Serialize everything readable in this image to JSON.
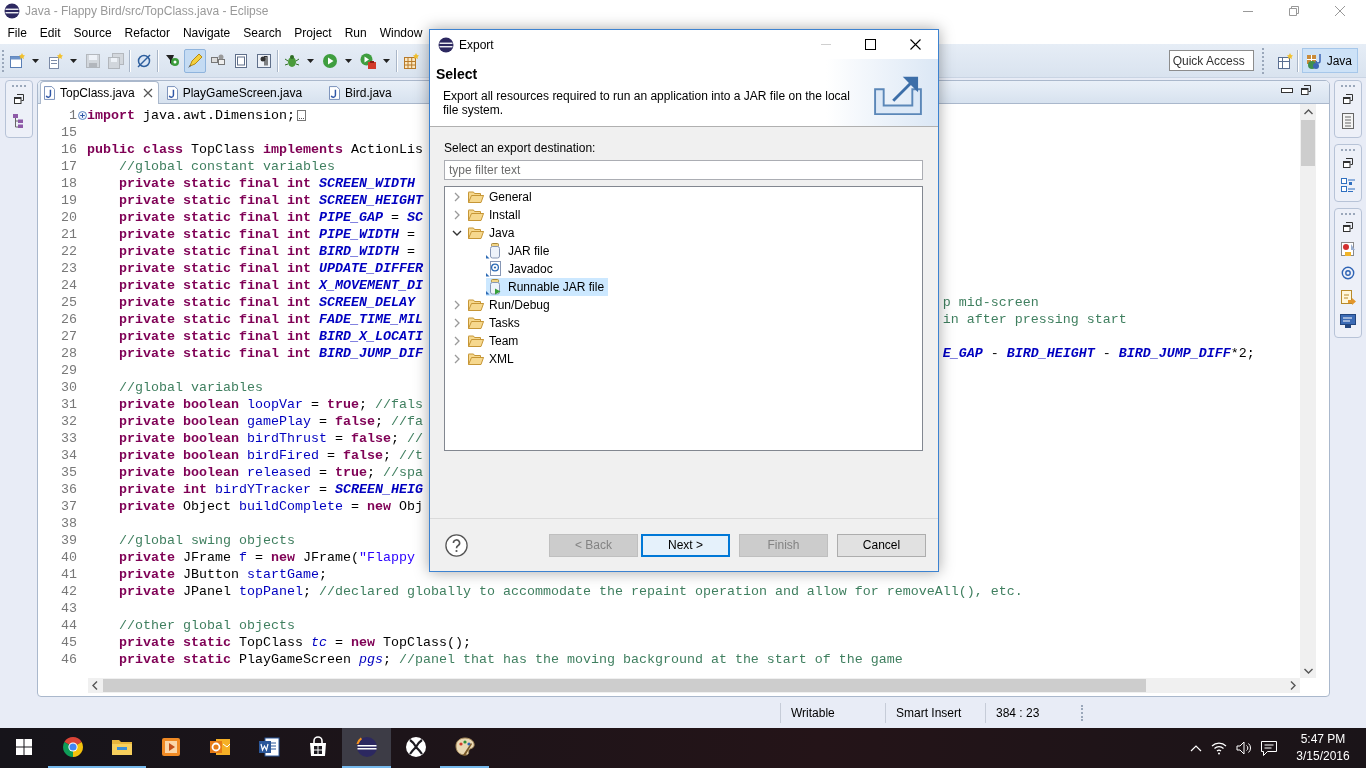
{
  "window": {
    "title": "Java - Flappy Bird/src/TopClass.java - Eclipse"
  },
  "menu": [
    "File",
    "Edit",
    "Source",
    "Refactor",
    "Navigate",
    "Search",
    "Project",
    "Run",
    "Window"
  ],
  "toolbar": [
    [
      {
        "kind": "new-window",
        "dropdown": true,
        "disabled": false,
        "pressed": false
      },
      {
        "kind": "new-page",
        "dropdown": true,
        "disabled": false,
        "pressed": false
      },
      {
        "kind": "save",
        "dropdown": false,
        "disabled": true,
        "pressed": false
      },
      {
        "kind": "save-all",
        "dropdown": false,
        "disabled": true,
        "pressed": false
      }
    ],
    [
      {
        "kind": "skip",
        "dropdown": false,
        "disabled": false,
        "pressed": false
      }
    ],
    [
      {
        "kind": "pin",
        "dropdown": false,
        "disabled": false,
        "pressed": false
      },
      {
        "kind": "highlighter",
        "dropdown": false,
        "disabled": false,
        "pressed": true
      },
      {
        "kind": "blocks",
        "dropdown": false,
        "disabled": false,
        "pressed": false
      },
      {
        "kind": "page",
        "dropdown": false,
        "disabled": false,
        "pressed": false
      },
      {
        "kind": "pilcrow",
        "dropdown": false,
        "disabled": false,
        "pressed": false
      }
    ],
    [
      {
        "kind": "bug",
        "dropdown": true,
        "disabled": false,
        "pressed": false
      },
      {
        "kind": "run",
        "dropdown": true,
        "disabled": false,
        "pressed": false
      },
      {
        "kind": "tools",
        "dropdown": true,
        "disabled": false,
        "pressed": false
      }
    ],
    [
      {
        "kind": "grid-plus",
        "dropdown": false,
        "disabled": false,
        "pressed": false
      }
    ]
  ],
  "quick_access": {
    "placeholder": "Quick Access"
  },
  "perspectives": [
    {
      "label": "Java",
      "selected": true
    }
  ],
  "editor": {
    "tabs": [
      {
        "label": "TopClass.java",
        "selected": true
      },
      {
        "label": "PlayGameScreen.java",
        "selected": false
      },
      {
        "label": "Bird.java",
        "selected": false
      }
    ],
    "lines": [
      {
        "number": "1",
        "folded": true,
        "code": [
          {
            "kind": "keyword",
            "text": "import"
          },
          {
            "kind": "plain",
            "text": " java.awt.Dimension;"
          }
        ]
      },
      {
        "number": "15",
        "folded": false
      },
      {
        "number": "16",
        "folded": false,
        "code": [
          {
            "kind": "keyword",
            "text": "public class"
          },
          {
            "kind": "plain",
            "text": " TopClass "
          },
          {
            "kind": "keyword",
            "text": "implements"
          },
          {
            "kind": "plain",
            "text": " ActionLis"
          }
        ],
        "children": [
          {
            "number": "17",
            "folded": false,
            "code": [
              {
                "kind": "comment",
                "text": "//global constant variables"
              }
            ]
          },
          {
            "number": "18",
            "folded": false,
            "code": [
              {
                "kind": "keyword",
                "text": "private static final int "
              },
              {
                "kind": "constant",
                "text": "SCREEN_WIDTH"
              }
            ]
          },
          {
            "number": "19",
            "folded": false,
            "code": [
              {
                "kind": "keyword",
                "text": "private static final int "
              },
              {
                "kind": "constant",
                "text": "SCREEN_HEIGHT"
              }
            ]
          },
          {
            "number": "20",
            "folded": false,
            "code": [
              {
                "kind": "keyword",
                "text": "private static final int "
              },
              {
                "kind": "constant",
                "text": "PIPE_GAP"
              },
              {
                "kind": "plain",
                "text": " = "
              },
              {
                "kind": "constant",
                "text": "SC"
              }
            ]
          },
          {
            "number": "21",
            "folded": false,
            "code": [
              {
                "kind": "keyword",
                "text": "private static final int "
              },
              {
                "kind": "constant",
                "text": "PIPE_WIDTH"
              },
              {
                "kind": "plain",
                "text": " ="
              }
            ]
          },
          {
            "number": "22",
            "folded": false,
            "code": [
              {
                "kind": "keyword",
                "text": "private static final int "
              },
              {
                "kind": "constant",
                "text": "BIRD_WIDTH"
              },
              {
                "kind": "plain",
                "text": " ="
              }
            ]
          },
          {
            "number": "23",
            "folded": false,
            "code": [
              {
                "kind": "keyword",
                "text": "private static final int "
              },
              {
                "kind": "constant",
                "text": "UPDATE_DIFFER"
              }
            ]
          },
          {
            "number": "24",
            "folded": false,
            "code": [
              {
                "kind": "keyword",
                "text": "private static final int "
              },
              {
                "kind": "constant",
                "text": "X_MOVEMENT_DI"
              }
            ]
          },
          {
            "number": "25",
            "folded": false,
            "code": [
              {
                "kind": "keyword",
                "text": "private static final int "
              },
              {
                "kind": "constant",
                "text": "SCREEN_DELAY"
              }
            ],
            "right_part": [
              {
                "kind": "comment",
                "text": "p mid-screen"
              }
            ]
          },
          {
            "number": "26",
            "folded": false,
            "code": [
              {
                "kind": "keyword",
                "text": "private static final int "
              },
              {
                "kind": "constant",
                "text": "FADE_TIME_MIL"
              }
            ],
            "right_part": [
              {
                "kind": "comment",
                "text": "in after pressing start"
              }
            ]
          },
          {
            "number": "27",
            "folded": false,
            "code": [
              {
                "kind": "keyword",
                "text": "private static final int "
              },
              {
                "kind": "constant",
                "text": "BIRD_X_LOCATI"
              }
            ]
          },
          {
            "number": "28",
            "folded": false,
            "code": [
              {
                "kind": "keyword",
                "text": "private static final int "
              },
              {
                "kind": "constant",
                "text": "BIRD_JUMP_DIF"
              }
            ],
            "right_part": [
              {
                "kind": "constant",
                "text": "E_GAP"
              },
              {
                "kind": "plain",
                "text": " - "
              },
              {
                "kind": "constant",
                "text": "BIRD_HEIGHT"
              },
              {
                "kind": "plain",
                "text": " - "
              },
              {
                "kind": "constant",
                "text": "BIRD_JUMP_DIFF"
              },
              {
                "kind": "plain",
                "text": "*2;"
              }
            ]
          },
          {
            "number": "29",
            "folded": false
          },
          {
            "number": "30",
            "folded": false,
            "code": [
              {
                "kind": "comment",
                "text": "//global variables"
              }
            ]
          },
          {
            "number": "31",
            "folded": false,
            "code": [
              {
                "kind": "keyword",
                "text": "private boolean "
              },
              {
                "kind": "field",
                "text": "loopVar"
              },
              {
                "kind": "plain",
                "text": " = "
              },
              {
                "kind": "keyword",
                "text": "true"
              },
              {
                "kind": "plain",
                "text": "; "
              },
              {
                "kind": "comment",
                "text": "//fals"
              }
            ]
          },
          {
            "number": "32",
            "folded": false,
            "code": [
              {
                "kind": "keyword",
                "text": "private boolean "
              },
              {
                "kind": "field",
                "text": "gamePlay"
              },
              {
                "kind": "plain",
                "text": " = "
              },
              {
                "kind": "keyword",
                "text": "false"
              },
              {
                "kind": "plain",
                "text": "; "
              },
              {
                "kind": "comment",
                "text": "//fa"
              }
            ]
          },
          {
            "number": "33",
            "folded": false,
            "code": [
              {
                "kind": "keyword",
                "text": "private boolean "
              },
              {
                "kind": "field",
                "text": "birdThrust"
              },
              {
                "kind": "plain",
                "text": " = "
              },
              {
                "kind": "keyword",
                "text": "false"
              },
              {
                "kind": "plain",
                "text": "; "
              },
              {
                "kind": "comment",
                "text": "//"
              }
            ]
          },
          {
            "number": "34",
            "folded": false,
            "code": [
              {
                "kind": "keyword",
                "text": "private boolean "
              },
              {
                "kind": "field",
                "text": "birdFired"
              },
              {
                "kind": "plain",
                "text": " = "
              },
              {
                "kind": "keyword",
                "text": "false"
              },
              {
                "kind": "plain",
                "text": "; "
              },
              {
                "kind": "comment",
                "text": "//t"
              }
            ]
          },
          {
            "number": "35",
            "folded": false,
            "code": [
              {
                "kind": "keyword",
                "text": "private boolean "
              },
              {
                "kind": "field",
                "text": "released"
              },
              {
                "kind": "plain",
                "text": " = "
              },
              {
                "kind": "keyword",
                "text": "true"
              },
              {
                "kind": "plain",
                "text": "; "
              },
              {
                "kind": "comment",
                "text": "//spa"
              }
            ]
          },
          {
            "number": "36",
            "folded": false,
            "code": [
              {
                "kind": "keyword",
                "text": "private int "
              },
              {
                "kind": "field",
                "text": "birdYTracker"
              },
              {
                "kind": "plain",
                "text": " = "
              },
              {
                "kind": "constant",
                "text": "SCREEN_HEIG"
              }
            ]
          },
          {
            "number": "37",
            "folded": false,
            "code": [
              {
                "kind": "keyword",
                "text": "private "
              },
              {
                "kind": "plain",
                "text": "Object "
              },
              {
                "kind": "field",
                "text": "buildComplete"
              },
              {
                "kind": "plain",
                "text": " = "
              },
              {
                "kind": "keyword",
                "text": "new"
              },
              {
                "kind": "plain",
                "text": " Obj"
              }
            ]
          },
          {
            "number": "38",
            "folded": false
          },
          {
            "number": "39",
            "folded": false,
            "code": [
              {
                "kind": "comment",
                "text": "//global swing objects"
              }
            ]
          },
          {
            "number": "40",
            "folded": false,
            "code": [
              {
                "kind": "keyword",
                "text": "private "
              },
              {
                "kind": "plain",
                "text": "JFrame "
              },
              {
                "kind": "field",
                "text": "f"
              },
              {
                "kind": "plain",
                "text": " = "
              },
              {
                "kind": "keyword",
                "text": "new"
              },
              {
                "kind": "plain",
                "text": " JFrame("
              },
              {
                "kind": "string",
                "text": "\"Flappy"
              }
            ]
          },
          {
            "number": "41",
            "folded": false,
            "code": [
              {
                "kind": "keyword",
                "text": "private "
              },
              {
                "kind": "plain",
                "text": "JButton "
              },
              {
                "kind": "field",
                "text": "startGame"
              },
              {
                "kind": "plain",
                "text": ";"
              }
            ]
          },
          {
            "number": "42",
            "folded": false,
            "code": [
              {
                "kind": "keyword",
                "text": "private "
              },
              {
                "kind": "plain",
                "text": "JPanel "
              },
              {
                "kind": "field",
                "text": "topPanel"
              },
              {
                "kind": "plain",
                "text": "; "
              },
              {
                "kind": "comment",
                "text": "//declared globally to accommodate the repaint operation and allow for removeAll(), etc."
              }
            ]
          },
          {
            "number": "43",
            "folded": false
          },
          {
            "number": "44",
            "folded": false,
            "code": [
              {
                "kind": "comment",
                "text": "//other global objects"
              }
            ]
          },
          {
            "number": "45",
            "folded": false,
            "code": [
              {
                "kind": "keyword",
                "text": "private static "
              },
              {
                "kind": "plain",
                "text": "TopClass "
              },
              {
                "kind": "static",
                "text": "tc"
              },
              {
                "kind": "plain",
                "text": " = "
              },
              {
                "kind": "keyword",
                "text": "new"
              },
              {
                "kind": "plain",
                "text": " TopClass();"
              }
            ]
          },
          {
            "number": "46",
            "folded": false,
            "code": [
              {
                "kind": "keyword",
                "text": "private static "
              },
              {
                "kind": "plain",
                "text": "PlayGameScreen "
              },
              {
                "kind": "static",
                "text": "pgs"
              },
              {
                "kind": "plain",
                "text": "; "
              },
              {
                "kind": "comment",
                "text": "//panel that has the moving background at the start of the game"
              }
            ]
          }
        ]
      }
    ]
  },
  "dialog": {
    "title": "Export",
    "window_buttons": [
      {
        "kind": "minimize",
        "disabled": true
      },
      {
        "kind": "maximize",
        "disabled": false
      },
      {
        "kind": "close",
        "disabled": false
      }
    ],
    "page_title": "Select",
    "description": "Export all resources required to run an application into a JAR file on the local file system.",
    "prompt": "Select an export destination:",
    "filter": {
      "placeholder": "type filter text"
    },
    "tree": [
      {
        "label": "General",
        "kind": "folder",
        "expanded": false,
        "selected": false
      },
      {
        "label": "Install",
        "kind": "folder",
        "expanded": false,
        "selected": false
      },
      {
        "label": "Java",
        "kind": "folder",
        "expanded": true,
        "selected": false,
        "children": [
          {
            "label": "JAR file",
            "kind": "jar",
            "selected": false
          },
          {
            "label": "Javadoc",
            "kind": "javadoc",
            "selected": false
          },
          {
            "label": "Runnable JAR file",
            "kind": "runnable-jar",
            "selected": true
          }
        ]
      },
      {
        "label": "Run/Debug",
        "kind": "folder",
        "expanded": false,
        "selected": false
      },
      {
        "label": "Tasks",
        "kind": "folder",
        "expanded": false,
        "selected": false
      },
      {
        "label": "Team",
        "kind": "folder",
        "expanded": false,
        "selected": false
      },
      {
        "label": "XML",
        "kind": "folder",
        "expanded": false,
        "selected": false
      }
    ],
    "buttons": [
      {
        "label": "< Back",
        "disabled": true,
        "default": false
      },
      {
        "label": "Next >",
        "disabled": false,
        "default": true
      },
      {
        "label": "Finish",
        "disabled": true,
        "default": false
      },
      {
        "label": "Cancel",
        "disabled": false,
        "default": false
      }
    ]
  },
  "status_bar": [
    "Writable",
    "Smart Insert",
    "384 : 23"
  ],
  "taskbar": {
    "apps": [
      {
        "kind": "browser",
        "running": true,
        "active": false
      },
      {
        "kind": "files",
        "running": true,
        "active": false
      },
      {
        "kind": "player",
        "running": false,
        "active": false
      },
      {
        "kind": "mail",
        "running": false,
        "active": false
      },
      {
        "kind": "writer",
        "running": false,
        "active": false
      },
      {
        "kind": "store",
        "running": false,
        "active": false
      },
      {
        "kind": "ide",
        "running": true,
        "active": true
      },
      {
        "kind": "game",
        "running": false,
        "active": false
      },
      {
        "kind": "paint",
        "running": true,
        "active": false
      }
    ],
    "clock": {
      "time": "5:47 PM",
      "date": "3/15/2016"
    }
  }
}
